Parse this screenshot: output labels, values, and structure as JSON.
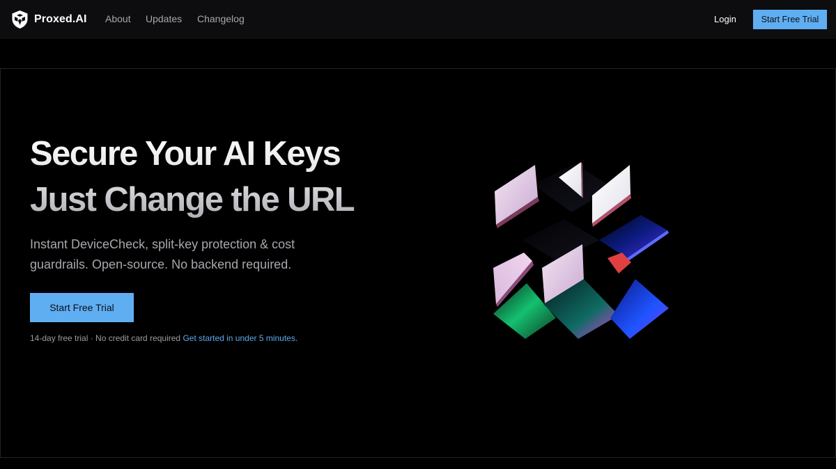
{
  "nav": {
    "brand": "Proxed.AI",
    "links": [
      "About",
      "Updates",
      "Changelog"
    ],
    "login": "Login",
    "cta": "Start Free Trial"
  },
  "hero": {
    "headline_line1": "Secure Your AI Keys",
    "headline_line2": "Just Change the URL",
    "subheadline": "Instant DeviceCheck, split-key protection & cost guardrails. Open-source. No backend required.",
    "cta": "Start Free Trial",
    "note": "14-day free trial · No credit card required",
    "note_link": "Get started in under 5 minutes."
  },
  "colors": {
    "accent": "#60aef2",
    "background": "#000000",
    "navbar": "#0d0d10"
  },
  "icons": {
    "brand": "shield-logo-icon",
    "artwork": "abstract-glass-tiles-illustration"
  }
}
